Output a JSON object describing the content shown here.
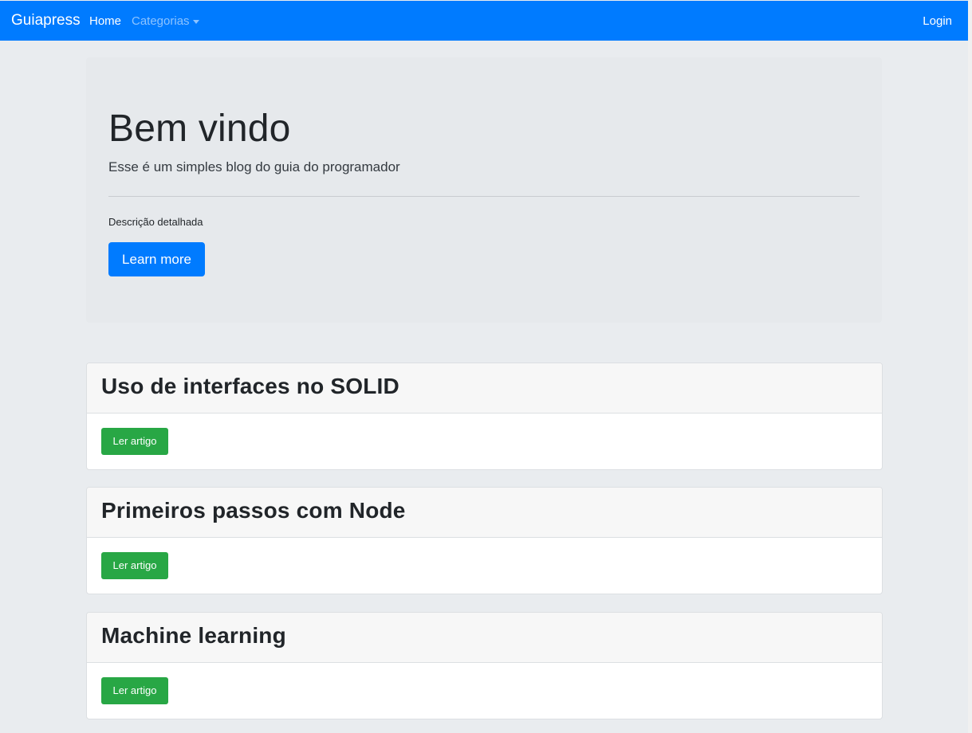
{
  "navbar": {
    "brand": "Guiapress",
    "home": "Home",
    "categorias": "Categorias",
    "login": "Login"
  },
  "hero": {
    "title": "Bem vindo",
    "lead": "Esse é um simples blog do guia do programador",
    "description": "Descrição detalhada",
    "button": "Learn more"
  },
  "articles": [
    {
      "title": "Uso de interfaces no SOLID",
      "button": "Ler artigo"
    },
    {
      "title": "Primeiros passos com Node",
      "button": "Ler artigo"
    },
    {
      "title": "Machine learning",
      "button": "Ler artigo"
    }
  ],
  "colors": {
    "primary": "#007bff",
    "success": "#28a745",
    "background": "#e9ecef"
  }
}
